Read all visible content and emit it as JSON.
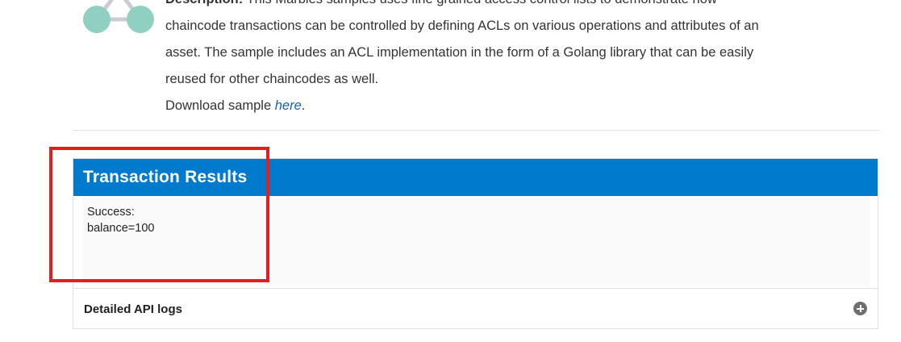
{
  "sample": {
    "icon": "network-nodes-icon",
    "description_label": "Description:",
    "description_line1": "This Marbles samples uses fine grained access control lists to demonstrate how",
    "description_line2": "chaincode transactions can be controlled by defining ACLs on various operations and attributes of an",
    "description_line3": "asset. The sample includes an ACL implementation in the form of a Golang library that can be easily",
    "description_line4": "reused for other chaincodes as well.",
    "download_prefix": "Download sample ",
    "download_link": "here",
    "download_suffix": "."
  },
  "results": {
    "title": "Transaction Results",
    "lines": [
      "Success:",
      "balance=100"
    ],
    "header_color": "#007acc"
  },
  "logs": {
    "label": "Detailed API logs",
    "expand_icon": "plus-circle-icon"
  },
  "annotation": {
    "color": "#e0201e"
  }
}
